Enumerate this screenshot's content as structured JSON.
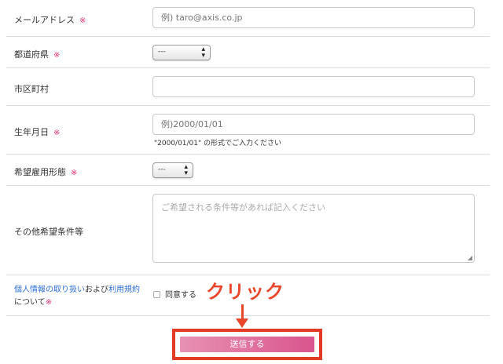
{
  "required_mark": "※",
  "fields": {
    "email": {
      "label": "メールアドレス",
      "placeholder": "例) taro@axis.co.jp"
    },
    "prefecture": {
      "label": "都道府県",
      "selected": "---"
    },
    "city": {
      "label": "市区町村",
      "value": ""
    },
    "birthdate": {
      "label": "生年月日",
      "placeholder": "例)2000/01/01",
      "hint": "\"2000/01/01\" の形式でご入力ください"
    },
    "employment_type": {
      "label": "希望雇用形態",
      "selected": "---"
    },
    "other": {
      "label": "その他希望条件等",
      "placeholder": "ご希望される条件等があれば記入ください"
    },
    "privacy": {
      "link_privacy": "個人情報の取り扱い",
      "and_text": "および",
      "link_terms": "利用規約",
      "tail_text": "について",
      "checkbox_label": "同意する"
    }
  },
  "annotation": {
    "click_text": "クリック"
  },
  "submit": {
    "label": "送信する"
  },
  "colors": {
    "required": "#e0337a",
    "link": "#2f6fd6",
    "callout": "#e8472b",
    "button_start": "#e891b2",
    "button_end": "#d9558d"
  }
}
